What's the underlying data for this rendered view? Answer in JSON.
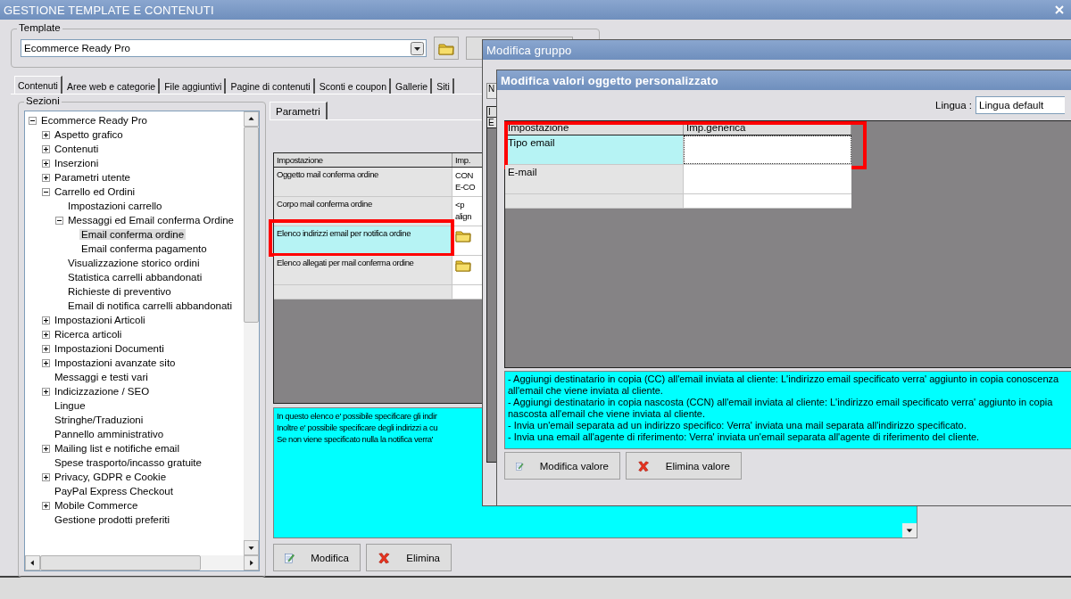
{
  "window": {
    "title": "GESTIONE TEMPLATE E CONTENUTI"
  },
  "template": {
    "label": "Template",
    "value": "Ecommerce Ready Pro"
  },
  "tabs": [
    {
      "label": "Contenuti",
      "selected": true
    },
    {
      "label": "Aree web e categorie",
      "selected": false
    },
    {
      "label": "File aggiuntivi",
      "selected": false
    },
    {
      "label": "Pagine di contenuti",
      "selected": false
    },
    {
      "label": "Sconti e coupon",
      "selected": false
    },
    {
      "label": "Gallerie",
      "selected": false
    },
    {
      "label": "Siti",
      "selected": false
    }
  ],
  "sections": {
    "label": "Sezioni",
    "tree": [
      {
        "label": "Ecommerce Ready Pro",
        "expanded": true,
        "selected": false,
        "children": [
          {
            "label": "Aspetto grafico",
            "expanded": false,
            "selected": false
          },
          {
            "label": "Contenuti",
            "expanded": false,
            "selected": false
          },
          {
            "label": "Inserzioni",
            "expanded": false,
            "selected": false
          },
          {
            "label": "Parametri utente",
            "expanded": false,
            "selected": false
          },
          {
            "label": "Carrello ed Ordini",
            "expanded": true,
            "selected": false,
            "children": [
              {
                "label": "Impostazioni carrello",
                "selected": false
              },
              {
                "label": "Messaggi ed Email conferma Ordine",
                "expanded": true,
                "selected": false,
                "children": [
                  {
                    "label": "Email conferma ordine",
                    "selected": true
                  },
                  {
                    "label": "Email conferma pagamento",
                    "selected": false
                  }
                ]
              },
              {
                "label": "Visualizzazione storico ordini",
                "selected": false
              },
              {
                "label": "Statistica carrelli abbandonati",
                "selected": false
              },
              {
                "label": "Richieste di preventivo",
                "selected": false
              },
              {
                "label": "Email di notifica carrelli abbandonati",
                "selected": false
              }
            ]
          },
          {
            "label": "Impostazioni Articoli",
            "expanded": false,
            "selected": false
          },
          {
            "label": "Ricerca articoli",
            "expanded": false,
            "selected": false
          },
          {
            "label": "Impostazioni Documenti",
            "expanded": false,
            "selected": false
          },
          {
            "label": "Impostazioni avanzate sito",
            "expanded": false,
            "selected": false
          },
          {
            "label": "Messaggi e testi vari",
            "selected": false
          },
          {
            "label": "Indicizzazione / SEO",
            "expanded": false,
            "selected": false
          },
          {
            "label": "Lingue",
            "selected": false
          },
          {
            "label": "Stringhe/Traduzioni",
            "selected": false
          },
          {
            "label": "Pannello amministrativo",
            "selected": false
          },
          {
            "label": "Mailing list e notifiche email",
            "expanded": false,
            "selected": false
          },
          {
            "label": "Spese trasporto/incasso gratuite",
            "selected": false
          },
          {
            "label": "Privacy, GDPR e Cookie",
            "expanded": false,
            "selected": false
          },
          {
            "label": "PayPal Express Checkout",
            "selected": false
          },
          {
            "label": "Mobile Commerce",
            "expanded": false,
            "selected": false
          },
          {
            "label": "Gestione prodotti preferiti",
            "selected": false
          }
        ]
      }
    ]
  },
  "params": {
    "tab": "Parametri",
    "columns": [
      "Impostazione",
      "Imp."
    ],
    "rows": [
      {
        "name": "Oggetto mail conferma ordine",
        "kind": "text",
        "value": [
          "CON",
          "E-CO"
        ],
        "selected": false,
        "highlighted": false
      },
      {
        "name": "Corpo mail conferma ordine",
        "kind": "text",
        "value": [
          "<p",
          "align"
        ],
        "selected": false,
        "highlighted": false
      },
      {
        "name": "Elenco indirizzi email per notifica ordine",
        "kind": "folder",
        "selected": true,
        "highlighted": true
      },
      {
        "name": "Elenco allegati per mail conferma ordine",
        "kind": "folder",
        "selected": false,
        "highlighted": false
      }
    ],
    "description": [
      "In questo elenco e' possibile specificare gli indir",
      "Inoltre e' possibile specificare degli indirizzi a cu",
      "Se non viene specificato nulla la notifica verra'"
    ],
    "buttons": [
      {
        "label": "Modifica",
        "kind": "edit"
      },
      {
        "label": "Elimina",
        "kind": "delete"
      }
    ]
  },
  "group_dialog": {
    "title": "Modifica gruppo",
    "field": "N",
    "column": "I",
    "cell": "E"
  },
  "values_dialog": {
    "title": "Modifica valori oggetto personalizzato",
    "language_label": "Lingua :",
    "language": "Lingua default",
    "columns": [
      "Impostazione",
      "Imp.generica"
    ],
    "rows": [
      {
        "name": "Tipo email",
        "selected": true,
        "highlighted": true
      },
      {
        "name": "E-mail",
        "selected": false,
        "highlighted": false
      }
    ],
    "description": [
      "- Aggiungi destinatario in copia (CC) all'email inviata al cliente: L'indirizzo email specificato verra' aggiunto in copia conoscenza all'email che viene inviata al cliente.",
      "- Aggiungi destinatario in copia nascosta (CCN) all'email inviata al cliente: L'indirizzo email specificato verra' aggiunto in copia nascosta all'email che viene inviata al cliente.",
      "- Invia un'email separata ad un indirizzo specifico: Verra' inviata una mail separata all'indirizzo specificato.",
      "- Invia una email all'agente di riferimento: Verra' inviata un'email separata all'agente di riferimento del cliente."
    ],
    "buttons": [
      {
        "label": "Modifica valore",
        "kind": "edit"
      },
      {
        "label": "Elimina valore",
        "kind": "delete"
      }
    ]
  }
}
